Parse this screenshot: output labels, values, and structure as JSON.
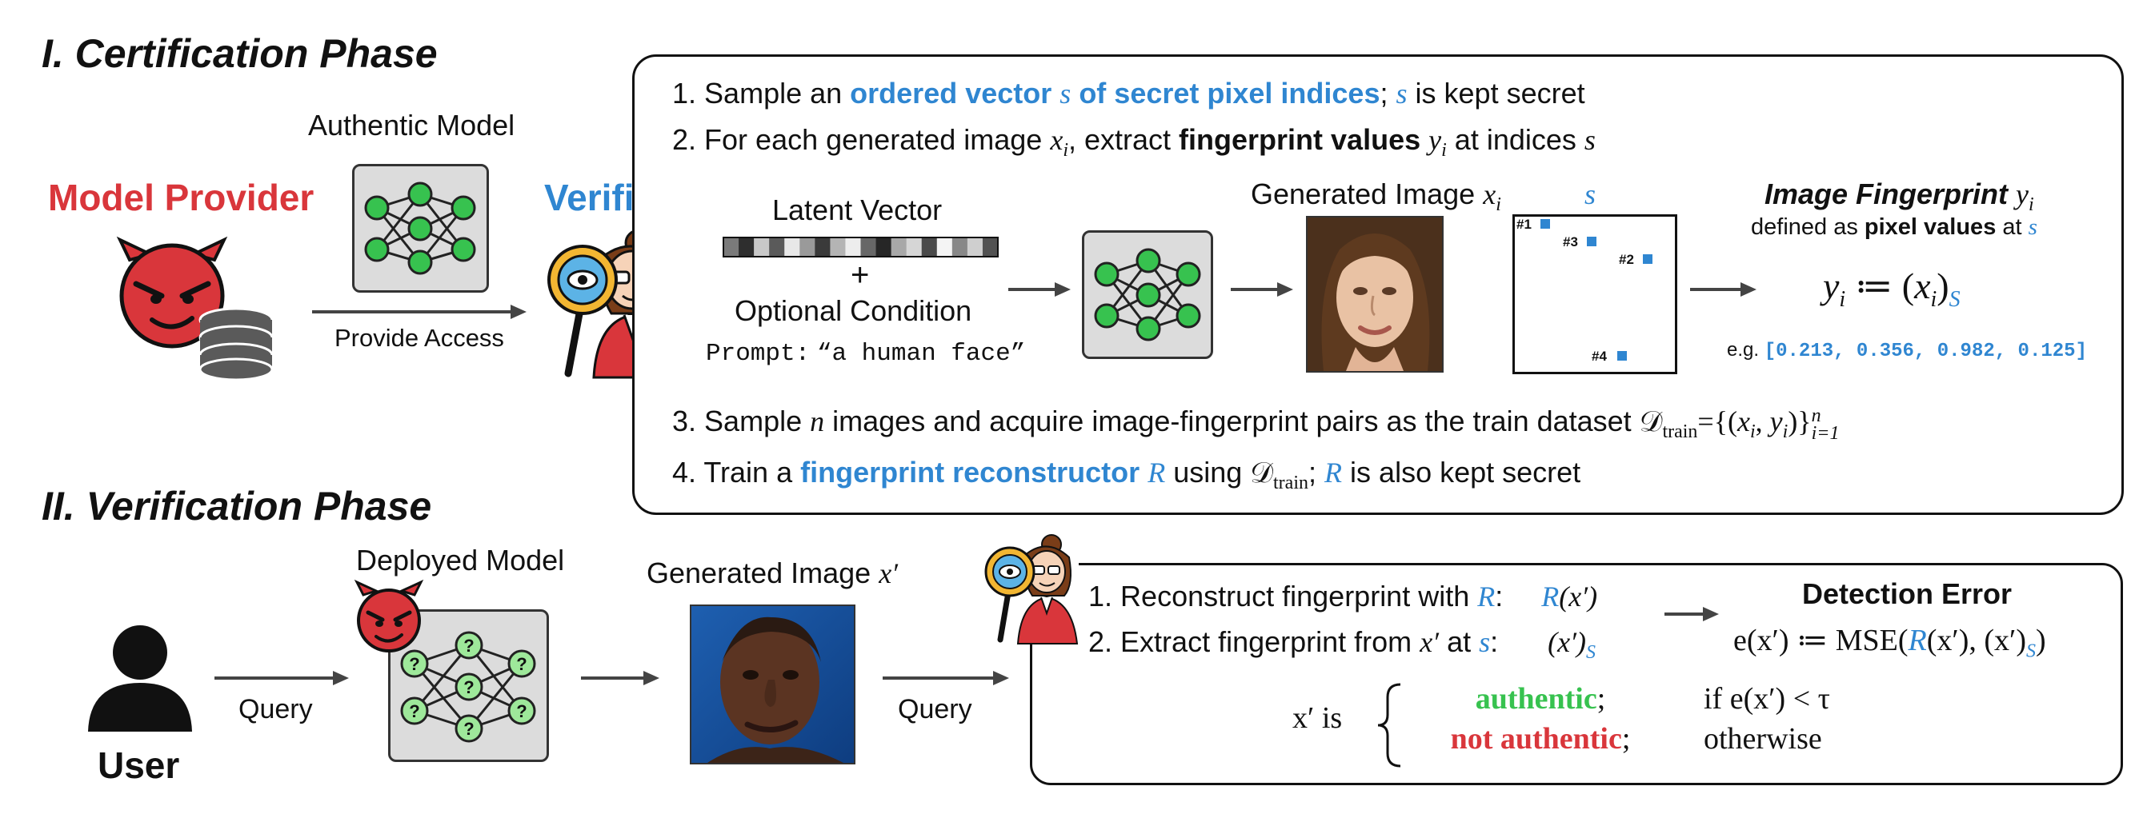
{
  "colors": {
    "blue": "#2f86d1",
    "red": "#d9363b",
    "green": "#37c24f",
    "nn_bg": "#dcdcdc",
    "node": "#37c24f",
    "node_q": "#9ee89a"
  },
  "cert": {
    "title": "I. Certification Phase",
    "model_provider": "Model Provider",
    "authentic_model": "Authentic Model",
    "provide_access": "Provide Access",
    "verifier": "Verifier",
    "step1": {
      "num": "1.",
      "a": "Sample an",
      "b": "ordered vector",
      "c": "s",
      "d": "of secret pixel indices",
      "e": ";",
      "f": "s",
      "g": "is kept secret"
    },
    "step2": {
      "num": "2.",
      "a": "For each generated image",
      "xi": "x",
      "xi_sub": "i",
      "b": ", extract",
      "c": "fingerprint values",
      "yi": "y",
      "yi_sub": "i",
      "d": "at indices",
      "s": "s"
    },
    "latent_vector": "Latent Vector",
    "plus": "+",
    "optional_condition": "Optional Condition",
    "prompt_label": "Prompt:",
    "prompt_value": "“a human face”",
    "generated_image": "Generated Image",
    "gen_x": "x",
    "gen_x_sub": "i",
    "s_label": "s",
    "pixel_markers": [
      "#1",
      "#3",
      "#2",
      "#4"
    ],
    "fp_title": "Image Fingerprint",
    "fp_y": "y",
    "fp_y_sub": "i",
    "fp_defined_a": "defined as",
    "fp_defined_b": "pixel values",
    "fp_defined_c": "at",
    "fp_defined_s": "s",
    "fp_formula_y": "y",
    "fp_formula_i": "i",
    "fp_formula_def": " ≔ (",
    "fp_formula_x": "x",
    "fp_formula_xi": "i",
    "fp_formula_close": ")",
    "fp_formula_s": "S",
    "eg_label": "e.g.",
    "eg_values": "[0.213, 0.356, 0.982, 0.125]",
    "step3": {
      "num": "3.",
      "a": "Sample",
      "n": "n",
      "b": "images and acquire image-fingerprint pairs as the train dataset",
      "D": "𝒟",
      "Dsub": "train",
      "eq": "={(",
      "x": "x",
      "xi": "i",
      "comma": ",",
      "y": "y",
      "yi": "i",
      "close": ")}",
      "sup": "n",
      "sub": "i=1"
    },
    "step4": {
      "num": "4.",
      "a": "Train a",
      "b": "fingerprint reconstructor",
      "R": "R",
      "c": "using",
      "D": "𝒟",
      "Dsub": "train",
      "d": ";",
      "R2": "R",
      "e": "is also kept secret"
    }
  },
  "verif": {
    "title": "II. Verification Phase",
    "user": "User",
    "query1": "Query",
    "deployed_model": "Deployed Model",
    "generated_image": "Generated Image",
    "gen_x": "x′",
    "query2": "Query",
    "step1": {
      "num": "1.",
      "a": "Reconstruct fingerprint with",
      "R": "R",
      "colon": ":",
      "Rx": "R",
      "Rx_arg": "(x′)"
    },
    "step2": {
      "num": "2.",
      "a": "Extract fingerprint from",
      "x": "x′",
      "b": "at",
      "s": "s",
      "colon": ":",
      "expr": "(x′)",
      "expr_sub": "S"
    },
    "detection_error": "Detection Error",
    "err_lhs": "e(x′) ≔ MSE(",
    "err_R": "R",
    "err_mid": "(x′), (x′)",
    "err_sub": "S",
    "err_close": ")",
    "x_is": "x′ is",
    "authentic": "authentic",
    "auth_semi": ";",
    "auth_cond": "if e(x′) < τ",
    "not_authentic": "not authentic",
    "not_semi": ";",
    "otherwise": "otherwise"
  }
}
